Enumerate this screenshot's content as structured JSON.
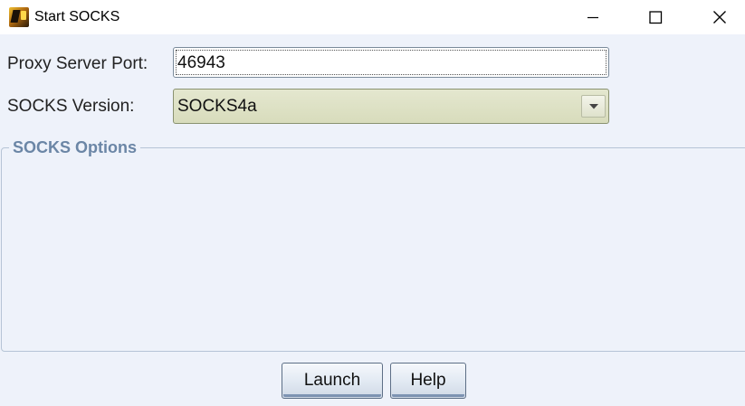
{
  "window": {
    "title": "Start SOCKS",
    "app_icon": "app-logo-icon",
    "controls": {
      "minimize_icon": "minimize-icon",
      "maximize_icon": "maximize-icon",
      "close_icon": "close-icon"
    }
  },
  "form": {
    "port_label": "Proxy Server Port:",
    "port_value": "46943",
    "version_label": "SOCKS Version:",
    "version_value": "SOCKS4a",
    "version_dropdown_icon": "chevron-down-icon"
  },
  "options_group": {
    "title": "SOCKS Options"
  },
  "buttons": {
    "launch_label": "Launch",
    "help_label": "Help"
  },
  "colors": {
    "background": "#eef2fa",
    "group_title": "#6b86a6",
    "combo_background": "#dfe2c6",
    "button_border": "#5d6f86"
  }
}
